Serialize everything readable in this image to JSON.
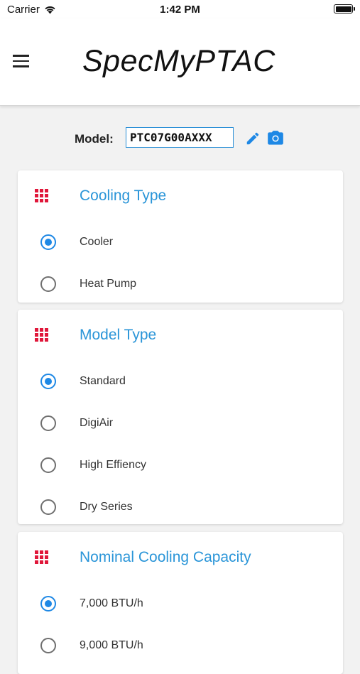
{
  "status_bar": {
    "carrier": "Carrier",
    "time": "1:42 PM"
  },
  "app_bar": {
    "title": "SpecMyPTAC"
  },
  "model": {
    "label": "Model:",
    "value": "PTC07G00AXXX"
  },
  "colors": {
    "accent": "#1e88e5",
    "title_blue": "#2a95d8",
    "grid_icon_red": "#e0173a"
  },
  "icons": [
    "wifi-icon",
    "battery-icon",
    "menu-icon",
    "edit-icon",
    "camera-icon",
    "grid-icon"
  ],
  "sections": {
    "cooling_type": {
      "title": "Cooling Type",
      "options": [
        {
          "label": "Cooler",
          "selected": true
        },
        {
          "label": "Heat Pump",
          "selected": false
        }
      ]
    },
    "model_type": {
      "title": "Model Type",
      "options": [
        {
          "label": "Standard",
          "selected": true
        },
        {
          "label": "DigiAir",
          "selected": false
        },
        {
          "label": "High Effiency",
          "selected": false
        },
        {
          "label": "Dry Series",
          "selected": false
        }
      ]
    },
    "capacity": {
      "title": "Nominal Cooling Capacity",
      "options": [
        {
          "label": "7,000 BTU/h",
          "selected": true
        },
        {
          "label": "9,000 BTU/h",
          "selected": false
        }
      ]
    }
  }
}
